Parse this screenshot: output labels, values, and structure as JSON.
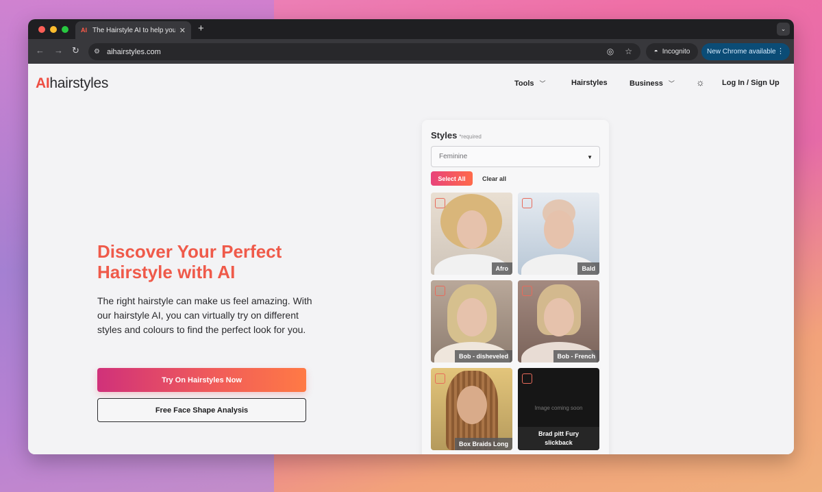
{
  "browser": {
    "tab_title": "The Hairstyle AI to help you f",
    "tab_favicon": "AI",
    "url": "aihairstyles.com",
    "incognito_label": "Incognito",
    "update_label": "New Chrome available"
  },
  "header": {
    "logo_ai": "AI",
    "logo_rest": "hairstyles",
    "nav": {
      "tools": "Tools",
      "hairstyles": "Hairstyles",
      "business": "Business",
      "login": "Log In / Sign Up"
    }
  },
  "hero": {
    "title_line1": "Discover Your Perfect",
    "title_line2": "Hairstyle with AI",
    "text": "The right hairstyle can make us feel amazing. With our hairstyle AI, you can virtually try on different styles and colours to find the perfect look for you.",
    "cta_primary": "Try On Hairstyles Now",
    "cta_secondary": "Free Face Shape Analysis"
  },
  "styles_panel": {
    "label": "Styles",
    "required": "*required",
    "select_value": "Feminine",
    "select_all": "Select All",
    "clear_all": "Clear all",
    "cards": [
      {
        "label": "Afro"
      },
      {
        "label": "Bald"
      },
      {
        "label": "Bob - disheveled"
      },
      {
        "label": "Bob - French"
      },
      {
        "label": "Box Braids Long"
      },
      {
        "label_line1": "Brad pitt Fury",
        "label_line2": "slickback",
        "placeholder": "Image coming soon"
      }
    ]
  },
  "colors": {
    "accent": "#ee4e43",
    "gradient_start": "#d0317a",
    "gradient_end": "#ff7a45"
  }
}
